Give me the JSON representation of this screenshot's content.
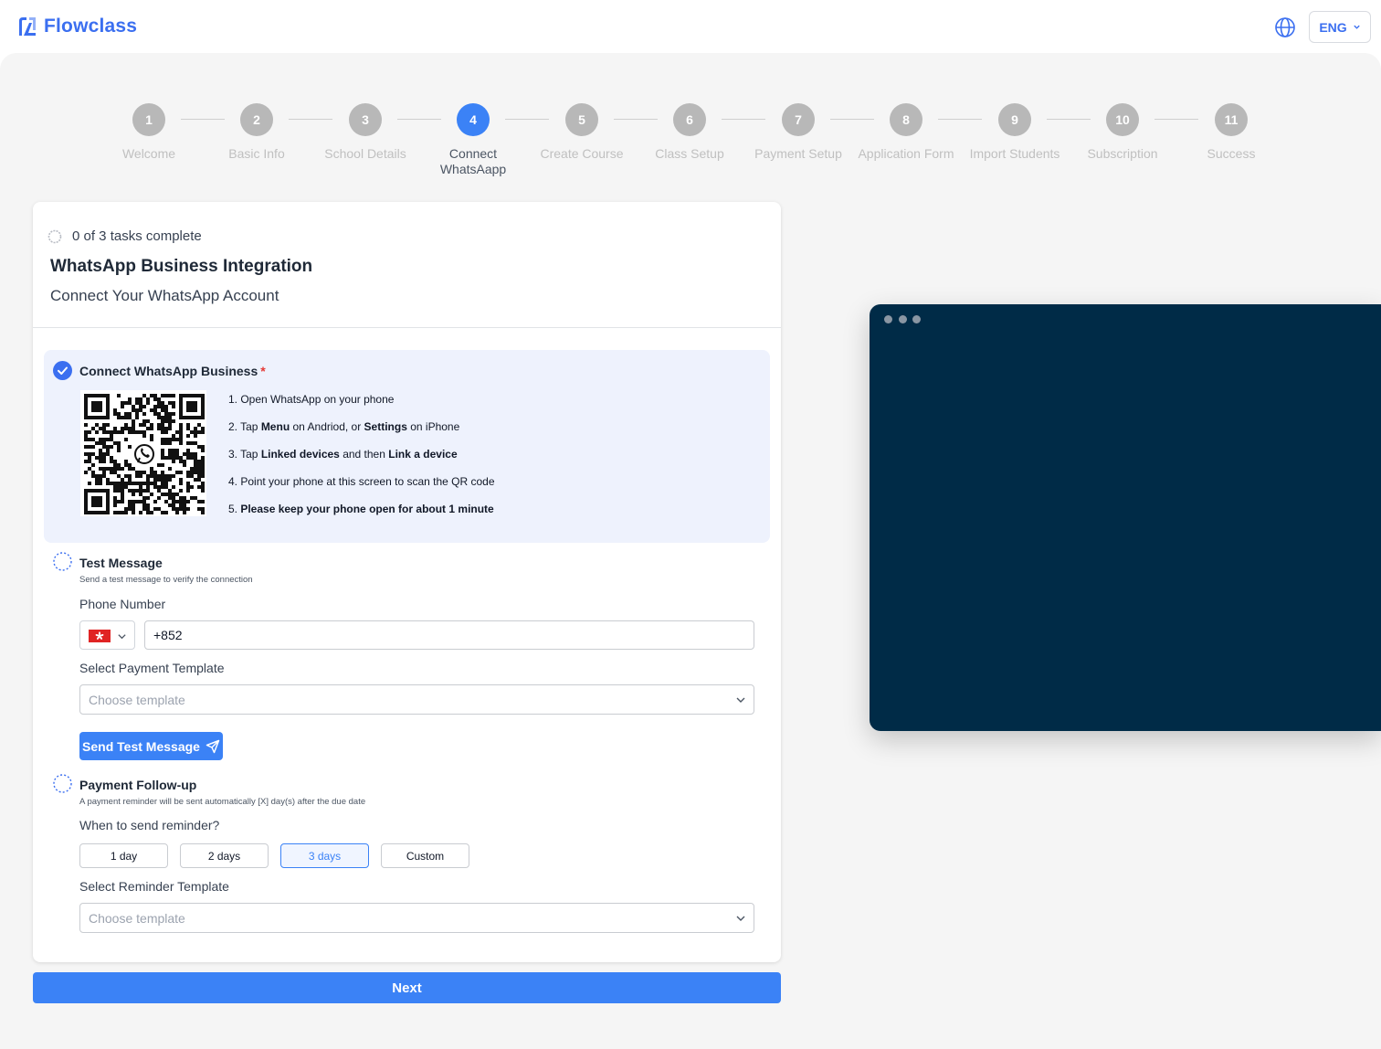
{
  "app": {
    "brand": "Flowclass",
    "brand_color": "#3b6ff0",
    "language": "ENG"
  },
  "steps": [
    {
      "number": "1",
      "label": "Welcome",
      "active": false
    },
    {
      "number": "2",
      "label": "Basic Info",
      "active": false
    },
    {
      "number": "3",
      "label": "School Details",
      "active": false
    },
    {
      "number": "4",
      "label": "Connect WhatsAapp",
      "active": true
    },
    {
      "number": "5",
      "label": "Create Course",
      "active": false
    },
    {
      "number": "6",
      "label": "Class Setup",
      "active": false
    },
    {
      "number": "7",
      "label": "Payment Setup",
      "active": false
    },
    {
      "number": "8",
      "label": "Application Form",
      "active": false
    },
    {
      "number": "9",
      "label": "Import Students",
      "active": false
    },
    {
      "number": "10",
      "label": "Subscription",
      "active": false
    },
    {
      "number": "11",
      "label": "Success",
      "active": false
    }
  ],
  "card": {
    "progress_text": "0 of 3 tasks complete",
    "title": "WhatsApp Business Integration",
    "subtitle": "Connect Your WhatsApp Account"
  },
  "connect": {
    "title": "Connect WhatsApp Business",
    "required_mark": "*",
    "instructions": [
      {
        "num": "1.",
        "parts": [
          {
            "t": "Open WhatsApp on your phone",
            "b": false
          }
        ]
      },
      {
        "num": "2.",
        "parts": [
          {
            "t": "Tap ",
            "b": false
          },
          {
            "t": "Menu",
            "b": true
          },
          {
            "t": " on Andriod, or ",
            "b": false
          },
          {
            "t": "Settings",
            "b": true
          },
          {
            "t": " on iPhone",
            "b": false
          }
        ]
      },
      {
        "num": "3.",
        "parts": [
          {
            "t": "Tap ",
            "b": false
          },
          {
            "t": "Linked devices",
            "b": true
          },
          {
            "t": " and then ",
            "b": false
          },
          {
            "t": "Link a device",
            "b": true
          }
        ]
      },
      {
        "num": "4.",
        "parts": [
          {
            "t": "Point your phone at this screen to scan the QR code",
            "b": false
          }
        ]
      },
      {
        "num": "5.",
        "parts": [
          {
            "t": "Please keep your phone open for about 1 minute",
            "b": true
          }
        ]
      }
    ]
  },
  "test_message": {
    "title": "Test Message",
    "description": "Send a test message to verify the connection",
    "phone_label": "Phone Number",
    "phone_value": "+852",
    "template_label": "Select Payment Template",
    "template_placeholder": "Choose template",
    "send_button": "Send Test Message"
  },
  "follow_up": {
    "title": "Payment Follow-up",
    "description": "A payment reminder will be sent automatically [X] day(s) after the due date",
    "when_label": "When to send reminder?",
    "options": [
      "1 day",
      "2 days",
      "3 days",
      "Custom"
    ],
    "selected_option": "3 days",
    "template_label": "Select Reminder Template",
    "template_placeholder": "Choose template"
  },
  "next_button": "Next",
  "colors": {
    "accent": "#3b82f6",
    "preview_bg": "#002b47",
    "task_highlight": "#eef2fd",
    "required": "#e53935"
  }
}
